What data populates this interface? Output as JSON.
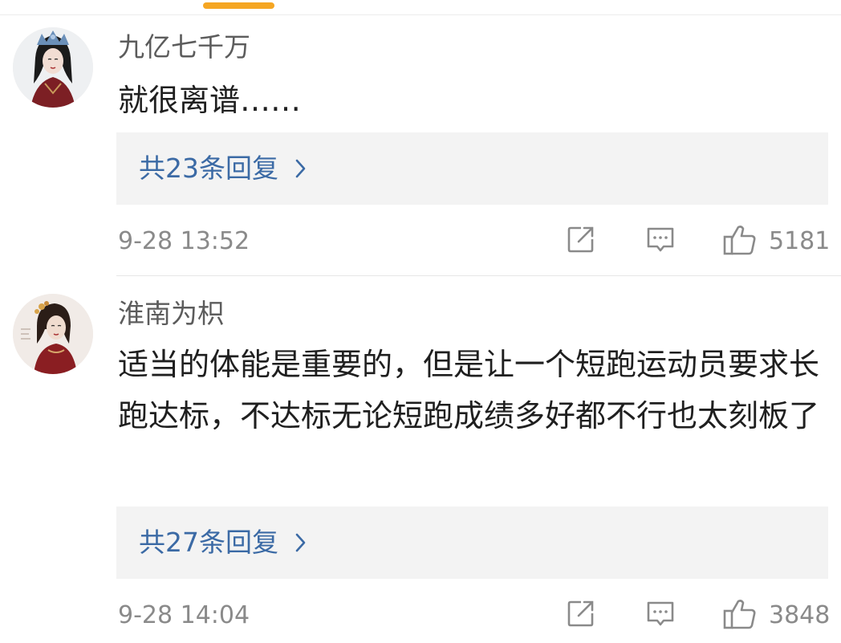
{
  "comments": [
    {
      "username": "九亿七千万",
      "body": "就很离谱……",
      "replies_label": "共23条回复",
      "timestamp": "9-28 13:52",
      "likes": "5181"
    },
    {
      "username": "淮南为枳",
      "body": "适当的体能是重要的，但是让一个短跑运动员要求长跑达标，不达标无论短跑成绩多好都不行也太刻板了",
      "replies_label": "共27条回复",
      "timestamp": "9-28 14:04",
      "likes": "3848"
    }
  ],
  "colors": {
    "accent_tab": "#f5a623",
    "reply_link": "#3b6aa5",
    "meta_text": "#8a8a8a",
    "reply_bg": "#f3f3f3"
  },
  "icons": {
    "share": "share-icon",
    "comment": "comment-icon",
    "like": "thumbs-up-icon",
    "chevron": "chevron-right-icon"
  }
}
